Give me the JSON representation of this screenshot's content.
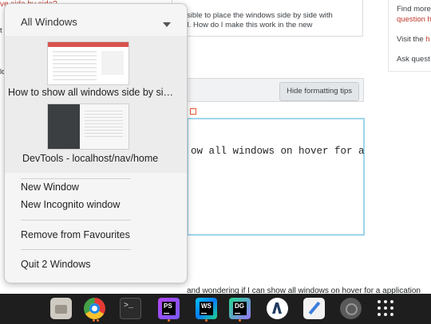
{
  "background_page": {
    "top_red_fragment": "ve side by side?",
    "question_lines": [
      "ossible to place the windows side by side with",
      "nal. How do I make this work in the new"
    ],
    "left_fragment_1": "t",
    "left_fragment_2": "lo",
    "right_panel": {
      "line1": "Find more",
      "link1": "question h",
      "line2_prefix": "Visit the ",
      "link2": "h",
      "line3": "Ask quest"
    },
    "hide_formatting_button": "Hide formatting tips",
    "editor_text": "ow all windows on hover for a",
    "bottom_text": "and wondering if I can show all windows on hover for a application"
  },
  "menu": {
    "header": "All Windows",
    "windows": [
      {
        "label": "How to show all windows side by si…"
      },
      {
        "label": "DevTools - localhost/nav/home"
      }
    ],
    "items": [
      {
        "label": "New Window"
      },
      {
        "label": "New Incognito window"
      },
      {
        "label": "Remove from Favourites"
      },
      {
        "label": "Quit 2 Windows"
      }
    ]
  },
  "dock": {
    "apps": [
      {
        "name": "files-icon"
      },
      {
        "name": "chrome-icon"
      },
      {
        "name": "terminal-icon",
        "glyph": ">_"
      },
      {
        "name": "phpstorm-icon",
        "text": "PS"
      },
      {
        "name": "webstorm-icon",
        "text": "WS"
      },
      {
        "name": "datagrip-icon",
        "text": "DG"
      },
      {
        "name": "odrive-icon"
      },
      {
        "name": "text-editor-icon"
      },
      {
        "name": "screen-recorder-icon"
      },
      {
        "name": "show-apps-icon"
      }
    ],
    "running_indicator_color": "#e8742a",
    "accent_color": "#c0392b",
    "focus_border_color": "#9ed6ea"
  }
}
